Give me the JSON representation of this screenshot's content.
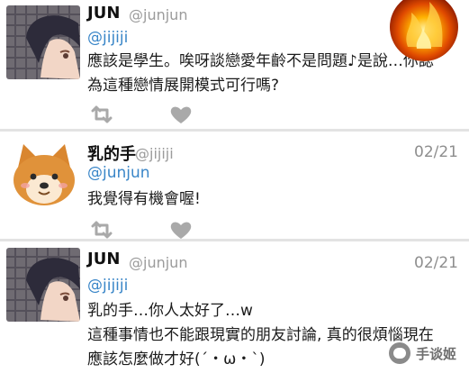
{
  "tweets": [
    {
      "author": "JUN",
      "handle": "@junjun",
      "date": "",
      "mention": "@jijiji",
      "lines": [
        "應該是學生。唉呀談戀愛年齡不是問題♪是說…你認",
        "為這種戀情展開模式可行嗎?"
      ],
      "avatar": "anime-boy-avatar"
    },
    {
      "author": "乳的手",
      "handle": "@jijiji",
      "date": "02/21",
      "mention": "@junjun",
      "lines": [
        "我覺得有機會喔!"
      ],
      "avatar": "shiba-dog-avatar"
    },
    {
      "author": "JUN",
      "handle": "@junjun",
      "date": "02/21",
      "mention": "@jijiji",
      "lines": [
        "乳的手…你人太好了…w",
        "這種事情也不能跟現實的朋友討論, 真的很煩惱現在",
        "應該怎麼做才好(´・ω・`)"
      ],
      "avatar": "anime-boy-avatar"
    }
  ],
  "actions": {
    "retweet_icon": "retweet-icon",
    "like_icon": "heart-icon"
  },
  "overlay": {
    "fire_avatar": "fire-avatar"
  },
  "watermark": {
    "text": "手谈姬"
  },
  "colors": {
    "mention": "#3a86c8",
    "handle": "#9b9b9b",
    "icon": "#a9a9a9",
    "divider": "#e3e3e3"
  }
}
